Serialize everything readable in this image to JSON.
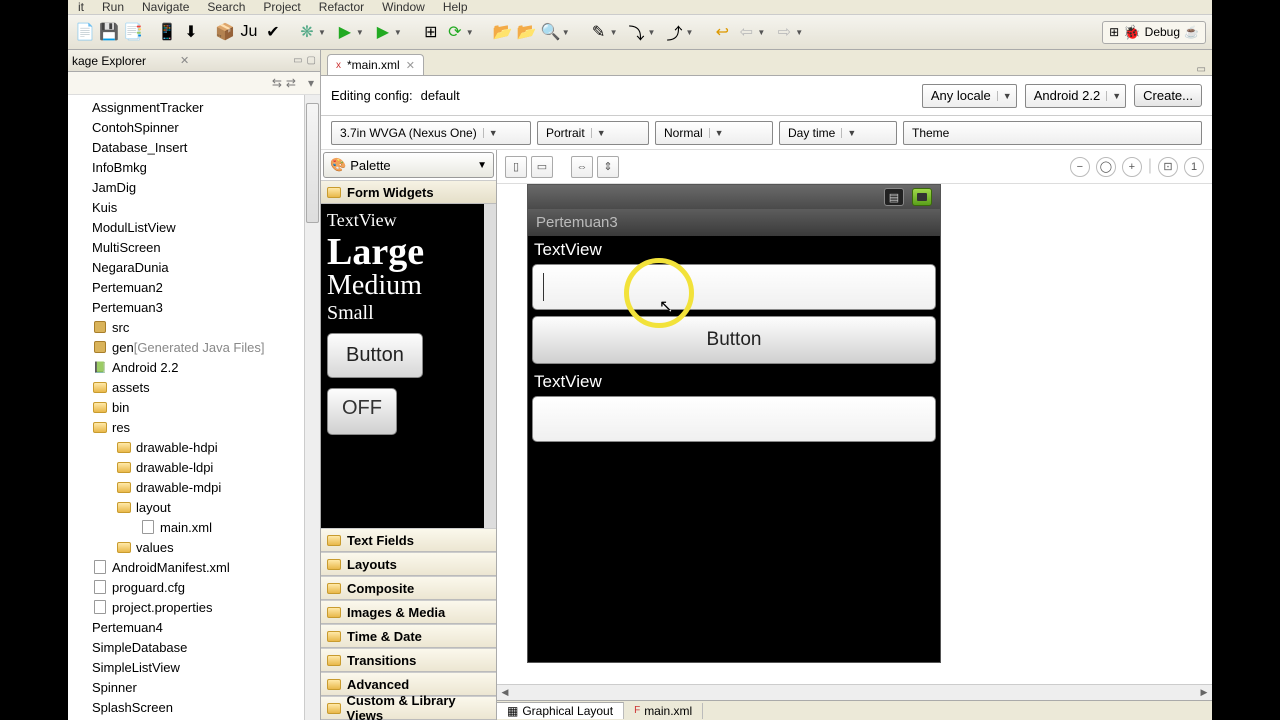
{
  "menu": {
    "items": [
      "it",
      "Run",
      "Navigate",
      "Search",
      "Project",
      "Refactor",
      "Window",
      "Help"
    ]
  },
  "perspective": {
    "label": "Debug"
  },
  "package_explorer": {
    "title": "kage Explorer",
    "items": [
      {
        "label": "AssignmentTracker",
        "depth": 0
      },
      {
        "label": "ContohSpinner",
        "depth": 0
      },
      {
        "label": "Database_Insert",
        "depth": 0
      },
      {
        "label": "InfoBmkg",
        "depth": 0
      },
      {
        "label": "JamDig",
        "depth": 0
      },
      {
        "label": "Kuis",
        "depth": 0
      },
      {
        "label": "ModulListView",
        "depth": 0
      },
      {
        "label": "MultiScreen",
        "depth": 0
      },
      {
        "label": "NegaraDunia",
        "depth": 0
      },
      {
        "label": "Pertemuan2",
        "depth": 0
      },
      {
        "label": "Pertemuan3",
        "depth": 0
      },
      {
        "label": "src",
        "depth": 1,
        "icon": "pkg"
      },
      {
        "label": "gen",
        "suffix": "[Generated Java Files]",
        "depth": 1,
        "icon": "pkg"
      },
      {
        "label": "Android 2.2",
        "depth": 1,
        "icon": "lib"
      },
      {
        "label": "assets",
        "depth": 1,
        "icon": "folder"
      },
      {
        "label": "bin",
        "depth": 1,
        "icon": "folder"
      },
      {
        "label": "res",
        "depth": 1,
        "icon": "folder"
      },
      {
        "label": "drawable-hdpi",
        "depth": 2,
        "icon": "folder"
      },
      {
        "label": "drawable-ldpi",
        "depth": 2,
        "icon": "folder"
      },
      {
        "label": "drawable-mdpi",
        "depth": 2,
        "icon": "folder"
      },
      {
        "label": "layout",
        "depth": 2,
        "icon": "folder"
      },
      {
        "label": "main.xml",
        "depth": 3,
        "icon": "file"
      },
      {
        "label": "values",
        "depth": 2,
        "icon": "folder"
      },
      {
        "label": "AndroidManifest.xml",
        "depth": 1,
        "icon": "file"
      },
      {
        "label": "proguard.cfg",
        "depth": 1,
        "icon": "file"
      },
      {
        "label": "project.properties",
        "depth": 1,
        "icon": "file"
      },
      {
        "label": "Pertemuan4",
        "depth": 0
      },
      {
        "label": "SimpleDatabase",
        "depth": 0
      },
      {
        "label": "SimpleListView",
        "depth": 0
      },
      {
        "label": "Spinner",
        "depth": 0
      },
      {
        "label": "SplashScreen",
        "depth": 0
      }
    ]
  },
  "editor": {
    "tab": "*main.xml",
    "config_label": "Editing config:",
    "config_value": "default",
    "locale": "Any locale",
    "platform": "Android 2.2",
    "create_btn": "Create...",
    "device": "3.7in WVGA (Nexus One)",
    "orientation": "Portrait",
    "density": "Normal",
    "daytime": "Day time",
    "theme": "Theme"
  },
  "palette": {
    "title": "Palette",
    "categories": [
      "Form Widgets",
      "Text Fields",
      "Layouts",
      "Composite",
      "Images & Media",
      "Time & Date",
      "Transitions",
      "Advanced",
      "Custom & Library Views"
    ],
    "form_widgets": {
      "textview": "TextView",
      "large": "Large",
      "medium": "Medium",
      "small": "Small",
      "button": "Button",
      "toggle": "OFF"
    }
  },
  "preview": {
    "app_title": "Pertemuan3",
    "tv1": "TextView",
    "button": "Button",
    "tv2": "TextView"
  },
  "bottom_tabs": {
    "graphical": "Graphical Layout",
    "source": "main.xml"
  }
}
